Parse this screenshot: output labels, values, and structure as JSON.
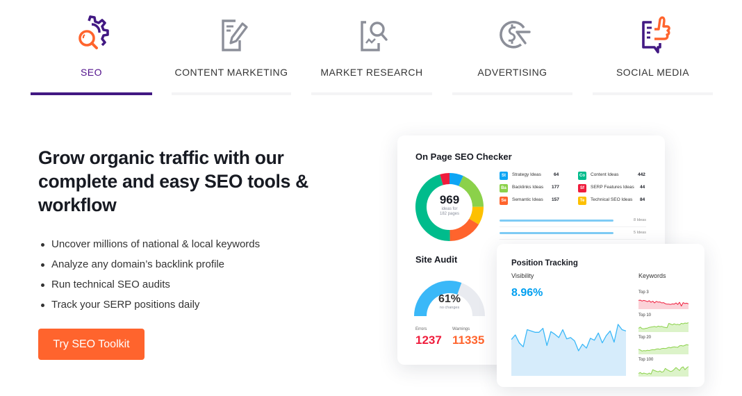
{
  "tabs": [
    {
      "label": "SEO",
      "icon": "seo-gear-magnifier-icon",
      "active": true
    },
    {
      "label": "CONTENT MARKETING",
      "icon": "edit-document-icon",
      "active": false
    },
    {
      "label": "MARKET RESEARCH",
      "icon": "research-magnifier-chart-icon",
      "active": false
    },
    {
      "label": "ADVERTISING",
      "icon": "dollar-cursor-icon",
      "active": false
    },
    {
      "label": "SOCIAL MEDIA",
      "icon": "chat-thumbs-up-icon",
      "active": false
    }
  ],
  "hero": {
    "headline": "Grow organic traffic with our complete and easy SEO tools & workflow",
    "bullets": [
      "Uncover millions of national & local keywords",
      "Analyze any domain’s backlink profile",
      "Run technical SEO audits",
      "Track your SERP positions daily"
    ],
    "cta_label": "Try SEO Toolkit"
  },
  "colors": {
    "accent_purple": "#421983",
    "cta_orange": "#ff642d",
    "blue": "#009ff0",
    "error_red": "#ef1c3c",
    "warning_orange": "#ff642d"
  },
  "on_page": {
    "title": "On Page SEO Checker",
    "total": "969",
    "total_sub_1": "ideas for",
    "total_sub_2": "182 pages",
    "legend": [
      {
        "abbr": "St",
        "label": "Strategy Ideas",
        "value": "64",
        "color": "#0ea5f4"
      },
      {
        "abbr": "Ba",
        "label": "Backlinks Ideas",
        "value": "177",
        "color": "#8bd14a"
      },
      {
        "abbr": "Se",
        "label": "Semantic Ideas",
        "value": "157",
        "color": "#ff642d"
      },
      {
        "abbr": "Co",
        "label": "Content Ideas",
        "value": "442",
        "color": "#00bc8c"
      },
      {
        "abbr": "Sf",
        "label": "SERP Features Ideas",
        "value": "44",
        "color": "#ef1c3c"
      },
      {
        "abbr": "Te",
        "label": "Technical SEO Ideas",
        "value": "84",
        "color": "#fdc000"
      }
    ],
    "idea_rows": [
      "8 Ideas",
      "5 Ideas"
    ]
  },
  "site_audit": {
    "title": "Site Audit",
    "percent_value": 61,
    "percent_label": "61%",
    "sub": "no changes",
    "errors_label": "Errors",
    "errors_value": "1237",
    "warnings_label": "Warnings",
    "warnings_value": "11335"
  },
  "position_tracking": {
    "title": "Position Tracking",
    "visibility_label": "Visibility",
    "visibility_value": "8.96%",
    "keywords_label": "Keywords",
    "visibility_series": [
      55,
      62,
      50,
      44,
      70,
      68,
      66,
      66,
      72,
      46,
      67,
      63,
      58,
      70,
      56,
      58,
      53,
      38,
      48,
      42,
      57,
      54,
      65,
      50,
      61,
      68,
      51,
      78,
      70,
      68
    ],
    "keyword_rows": [
      {
        "label": "Top 3",
        "color": "#ef1c3c",
        "fill": "#fbd2d8",
        "series": [
          70,
          72,
          65,
          70,
          66,
          60,
          68,
          55,
          64,
          50,
          62,
          56,
          58,
          50,
          52,
          44,
          40,
          40,
          38,
          42,
          40,
          50,
          38,
          55,
          25,
          52,
          45,
          48,
          42
        ]
      },
      {
        "label": "Top 10",
        "color": "#8bd14a",
        "fill": "#dcf3c9",
        "series": [
          30,
          40,
          28,
          26,
          30,
          32,
          38,
          40,
          42,
          45,
          40,
          48,
          44,
          46,
          40,
          38,
          35,
          70,
          64,
          58,
          66,
          60,
          62,
          58,
          70,
          66,
          72,
          70,
          75
        ]
      },
      {
        "label": "Top 20",
        "color": "#8bd14a",
        "fill": "#dcf3c9",
        "series": [
          40,
          35,
          26,
          30,
          28,
          33,
          30,
          35,
          38,
          36,
          42,
          44,
          40,
          46,
          48,
          46,
          50,
          56,
          52,
          58,
          60,
          58,
          56,
          68,
          70,
          66,
          72,
          78,
          74
        ]
      },
      {
        "label": "Top 100",
        "color": "#8bd14a",
        "fill": "#dcf3c9",
        "series": [
          25,
          32,
          22,
          28,
          24,
          20,
          28,
          20,
          55,
          48,
          42,
          38,
          45,
          35,
          40,
          65,
          55,
          48,
          40,
          45,
          58,
          72,
          60,
          48,
          70,
          78,
          55,
          70,
          80
        ]
      }
    ]
  }
}
